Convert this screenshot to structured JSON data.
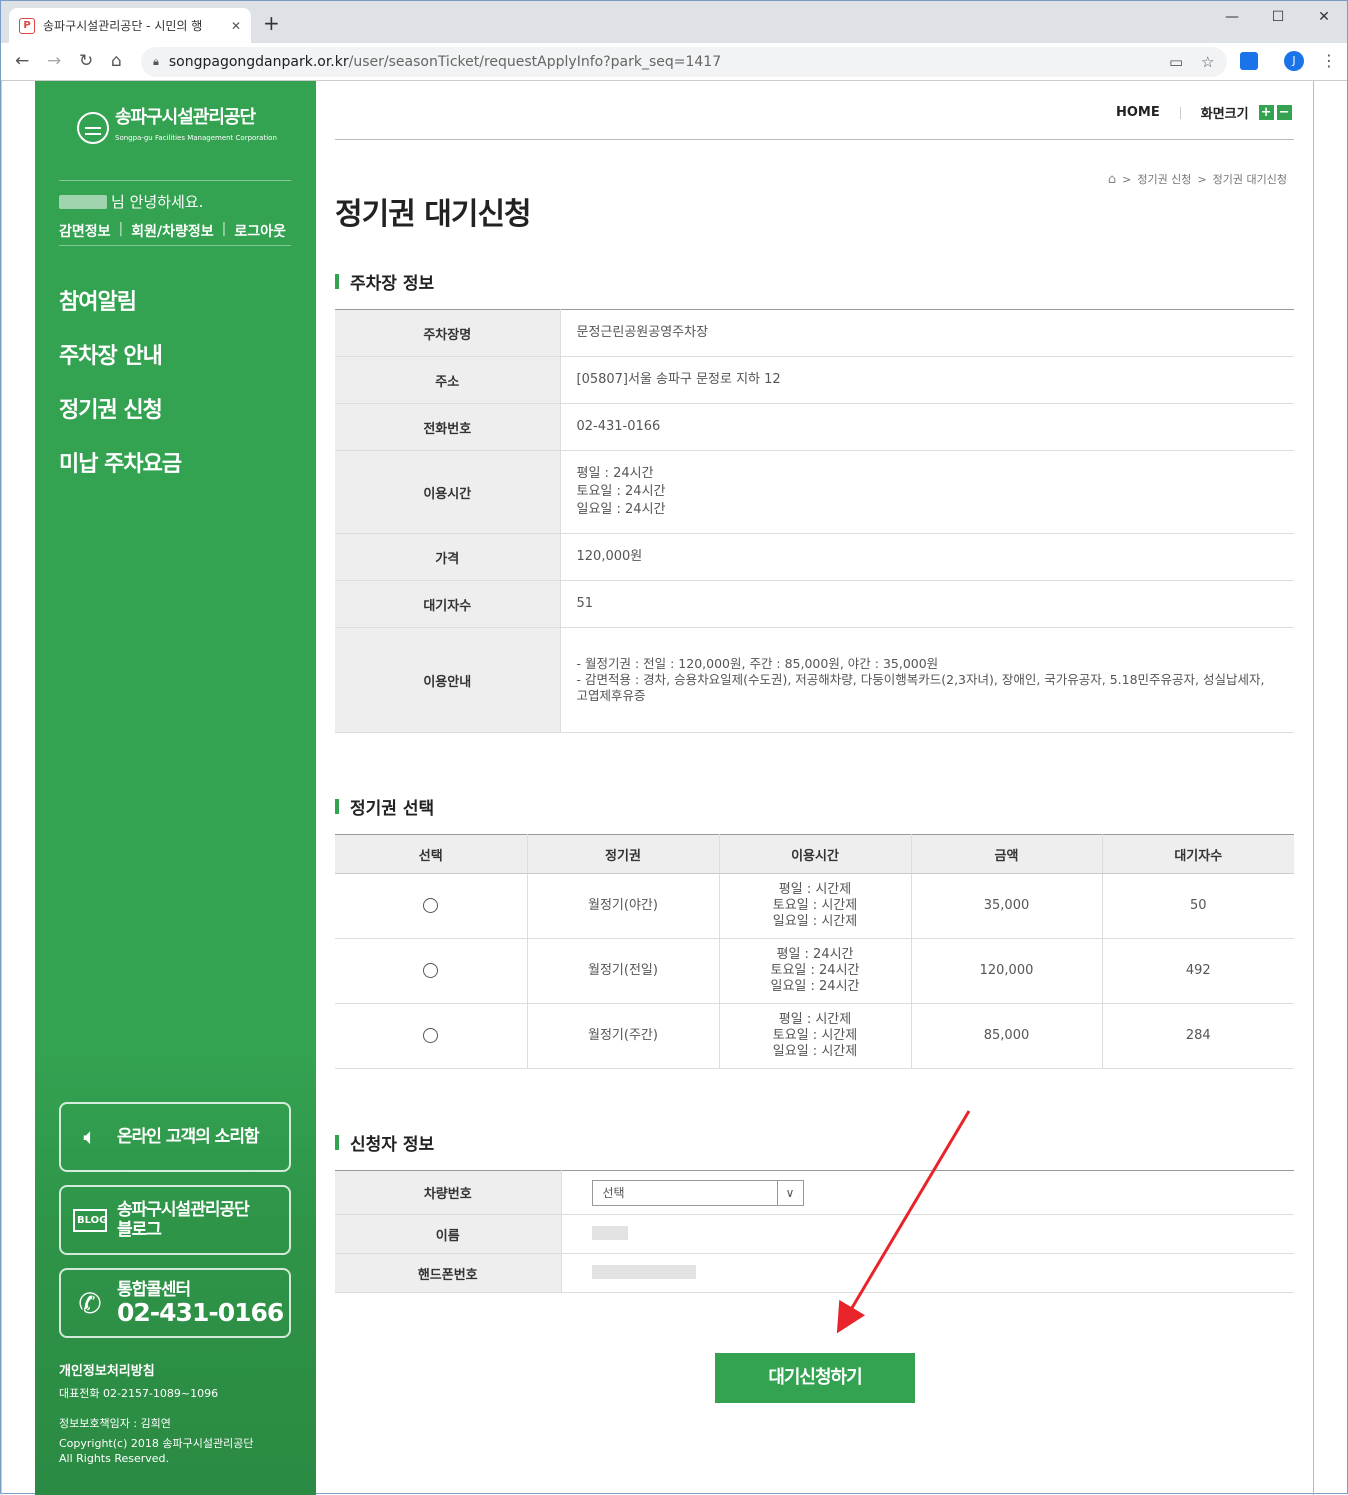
{
  "browser": {
    "tab_title": "송파구시설관리공단 - 시민의 행",
    "tab_close": "✕",
    "new_tab": "+",
    "url_host": "songpagongdanpark.or.kr",
    "url_path": "/user/seasonTicket/requestApplyInfo?park_seq=1417",
    "profile_initial": "J"
  },
  "sidebar": {
    "logo_name": "송파구시설관리공단",
    "logo_en": "Songpa-gu Facilities Management Corporation",
    "greeting": "님 안녕하세요.",
    "user_links": [
      "감면정보",
      "회원/차량정보",
      "로그아웃"
    ],
    "menu": [
      "참여알림",
      "주차장 안내",
      "정기권 신청",
      "미납 주차요금"
    ],
    "voice_btn": "온라인 고객의 소리함",
    "blog_icon": "BLOG",
    "blog_btn_line1": "송파구시설관리공단",
    "blog_btn_line2": "블로그",
    "call_label": "통합콜센터",
    "call_number": "02-431-0166",
    "privacy": "개인정보처리방침",
    "rep_phone": "대표전화 02-2157-1089~1096",
    "privacy_officer": "정보보호책임자 : 김희연",
    "copyright1": "Copyright(c) 2018 송파구시설관리공단",
    "copyright2": "All Rights Reserved."
  },
  "header": {
    "home": "HOME",
    "font_size": "화면크기",
    "plus": "+",
    "minus": "−"
  },
  "breadcrumb": [
    "정기권 신청",
    "정기권 대기신청"
  ],
  "page_title": "정기권 대기신청",
  "parking_info": {
    "title": "주차장 정보",
    "rows": [
      {
        "label": "주차장명",
        "value": "문정근린공원공영주차장"
      },
      {
        "label": "주소",
        "value": "[05807]서울 송파구 문정로 지하 12"
      },
      {
        "label": "전화번호",
        "value": "02-431-0166"
      },
      {
        "label": "이용시간",
        "lines": [
          "평일 : 24시간",
          "토요일 : 24시간",
          "일요일 : 24시간"
        ]
      },
      {
        "label": "가격",
        "value": "120,000원"
      },
      {
        "label": "대기자수",
        "value": "51"
      },
      {
        "label": "이용안내",
        "lines": [
          "- 월정기권 : 전일 : 120,000원, 주간 : 85,000원, 야간 : 35,000원",
          "- 감면적용 : 경차, 승용차요일제(수도권), 저공해차량, 다둥이행복카드(2,3자녀), 장애인, 국가유공자, 5.18민주유공자, 성실납세자, 고엽제후유증"
        ]
      }
    ]
  },
  "ticket_select": {
    "title": "정기권 선택",
    "headers": [
      "선택",
      "정기권",
      "이용시간",
      "금액",
      "대기자수"
    ],
    "rows": [
      {
        "name": "월정기(야간)",
        "times": [
          "평일 : 시간제",
          "토요일 : 시간제",
          "일요일 : 시간제"
        ],
        "price": "35,000",
        "waiting": "50"
      },
      {
        "name": "월정기(전일)",
        "times": [
          "평일 : 24시간",
          "토요일 : 24시간",
          "일요일 : 24시간"
        ],
        "price": "120,000",
        "waiting": "492"
      },
      {
        "name": "월정기(주간)",
        "times": [
          "평일 : 시간제",
          "토요일 : 시간제",
          "일요일 : 시간제"
        ],
        "price": "85,000",
        "waiting": "284"
      }
    ]
  },
  "applicant": {
    "title": "신청자 정보",
    "car_label": "차량번호",
    "car_select": "선택",
    "name_label": "이름",
    "phone_label": "핸드폰번호"
  },
  "submit_label": "대기신청하기",
  "colors": {
    "brand_green": "#33a251",
    "annotation_arrow": "#e8232a"
  },
  "icons": [
    "back-icon",
    "forward-icon",
    "reload-icon",
    "home-icon",
    "lock-icon",
    "cast-icon",
    "star-icon",
    "speaker-icon",
    "phone-icon"
  ]
}
